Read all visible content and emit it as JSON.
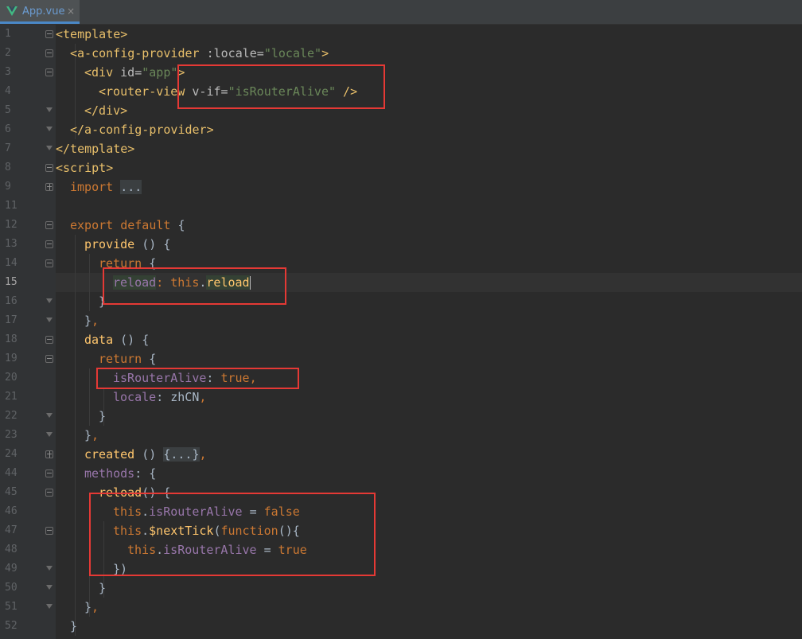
{
  "tab": {
    "file_name": "App.vue",
    "close_symbol": "×",
    "icon": "vue-logo-icon"
  },
  "gutter": {
    "line_numbers": [
      "1",
      "2",
      "3",
      "4",
      "5",
      "6",
      "7",
      "8",
      "9",
      "11",
      "12",
      "13",
      "14",
      "15",
      "16",
      "17",
      "18",
      "19",
      "20",
      "21",
      "22",
      "23",
      "24",
      "44",
      "45",
      "46",
      "47",
      "48",
      "49",
      "50",
      "51",
      "52"
    ],
    "current_line": "15"
  },
  "code": {
    "l1": {
      "a": "<template>"
    },
    "l2": {
      "a": "<a-config-provider",
      "b": " :locale=",
      "c": "\"locale\"",
      "d": ">"
    },
    "l3": {
      "a": "<div",
      "b": " id=",
      "c": "\"app\"",
      "d": ">"
    },
    "l4": {
      "a": "<router-view",
      "b": " v-if=",
      "c": "\"isRouterAlive\"",
      "d": " />"
    },
    "l5": {
      "a": "</div>"
    },
    "l6": {
      "a": "</a-config-provider>"
    },
    "l7": {
      "a": "</template>"
    },
    "l8": {
      "a": "<script>"
    },
    "l9": {
      "a": "import",
      "b": " ",
      "c": "..."
    },
    "l11": {
      "a": "export",
      "b": " ",
      "c": "default",
      "d": " {"
    },
    "l12": {
      "a": "provide",
      "b": " () {"
    },
    "l13": {
      "a": "return",
      "b": " {"
    },
    "l14": {
      "a": "reload",
      "b": ": ",
      "c": "this",
      "d": ".",
      "e": "reload"
    },
    "l15": {
      "a": "}"
    },
    "l16": {
      "a": "}",
      "b": ","
    },
    "l17": {
      "a": "data",
      "b": " () {"
    },
    "l18": {
      "a": "return",
      "b": " {"
    },
    "l19": {
      "a": "isRouterAlive",
      "b": ": ",
      "c": "true",
      "d": ","
    },
    "l20": {
      "a": "locale",
      "b": ": zhCN",
      "c": ","
    },
    "l21": {
      "a": "}"
    },
    "l22": {
      "a": "}",
      "b": ","
    },
    "l23": {
      "a": "created",
      "b": " () ",
      "c": "{...}",
      "d": ","
    },
    "l24": {
      "a": "methods",
      "b": ": {"
    },
    "l25": {
      "a": "reload",
      "b": "() {"
    },
    "l26": {
      "a": "this",
      "b": ".",
      "c": "isRouterAlive",
      "d": " = ",
      "e": "false"
    },
    "l27": {
      "a": "this",
      "b": ".",
      "c": "$nextTick",
      "d": "(",
      "e": "function",
      "f": "(){"
    },
    "l28": {
      "a": "this",
      "b": ".",
      "c": "isRouterAlive",
      "d": " = ",
      "e": "true"
    },
    "l29": {
      "a": "})"
    },
    "l30": {
      "a": "}"
    },
    "l31": {
      "a": "}",
      "b": ","
    },
    "l32": {
      "a": "}"
    }
  },
  "colors": {
    "red_box": "#e53935",
    "background": "#2b2b2b",
    "gutter": "#313335"
  }
}
